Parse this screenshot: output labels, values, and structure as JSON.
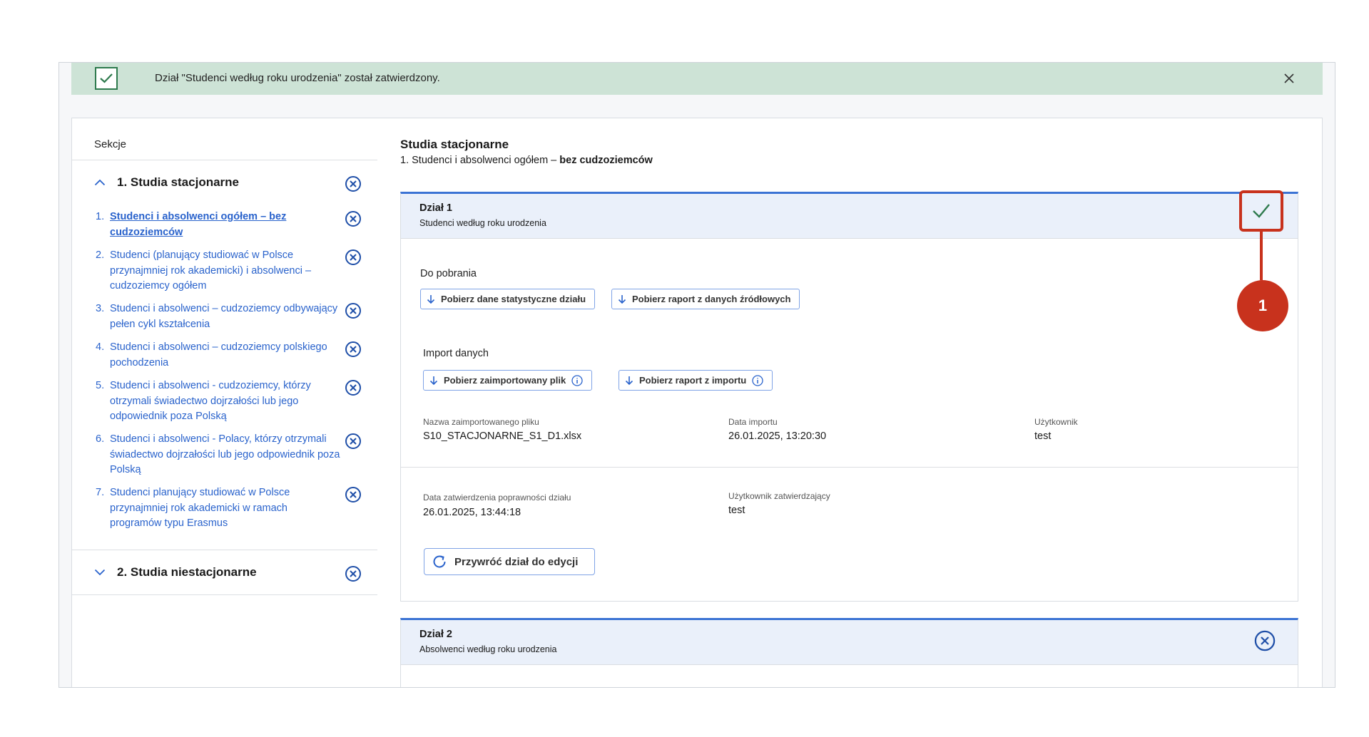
{
  "alert": {
    "message": "Dział \"Studenci według roku urodzenia\" został zatwierdzony."
  },
  "sidebar": {
    "title": "Sekcje",
    "groups": [
      {
        "label": "1. Studia stacjonarne"
      },
      {
        "label": "2. Studia niestacjonarne"
      }
    ],
    "items": [
      {
        "num": "1.",
        "label": "Studenci i absolwenci ogółem – bez cudzoziemców"
      },
      {
        "num": "2.",
        "label": "Studenci (planujący studiować w Polsce przynajmniej rok akademicki) i absolwenci – cudzoziemcy ogółem"
      },
      {
        "num": "3.",
        "label": "Studenci i absolwenci – cudzoziemcy odbywający pełen cykl kształcenia"
      },
      {
        "num": "4.",
        "label": "Studenci i absolwenci – cudzoziemcy polskiego pochodzenia"
      },
      {
        "num": "5.",
        "label": "Studenci i absolwenci - cudzoziemcy, którzy otrzymali świadectwo dojrzałości lub jego odpowiednik poza Polską"
      },
      {
        "num": "6.",
        "label": "Studenci i absolwenci - Polacy, którzy otrzymali świadectwo dojrzałości lub jego odpowiednik poza Polską"
      },
      {
        "num": "7.",
        "label": "Studenci planujący studiować w Polsce przynajmniej rok akademicki w ramach programów typu Erasmus"
      }
    ]
  },
  "main": {
    "title": "Studia stacjonarne",
    "subtitle_prefix": "1. Studenci i absolwenci ogółem – ",
    "subtitle_bold": "bez cudzoziemców",
    "section1": {
      "title": "Dział 1",
      "subtitle": "Studenci według roku urodzenia",
      "download_label": "Do pobrania",
      "btn_stats": "Pobierz dane statystyczne działu",
      "btn_source_report": "Pobierz raport z danych źródłowych",
      "import_label": "Import danych",
      "btn_imported_file": "Pobierz zaimportowany plik",
      "btn_import_report": "Pobierz raport z importu",
      "file_name_label": "Nazwa zaimportowanego pliku",
      "file_name": "S10_STACJONARNE_S1_D1.xlsx",
      "import_date_label": "Data importu",
      "import_date": "26.01.2025, 13:20:30",
      "user_label": "Użytkownik",
      "user": "test",
      "approval_date_label": "Data zatwierdzenia poprawności działu",
      "approval_date": "26.01.2025, 13:44:18",
      "approver_label": "Użytkownik zatwierdzający",
      "approver": "test",
      "restore_btn": "Przywróć dział do edycji"
    },
    "section2": {
      "title": "Dział 2",
      "subtitle": "Absolwenci według roku urodzenia"
    }
  },
  "callout": {
    "number": "1"
  },
  "colors": {
    "accent": "#3b73d4",
    "success": "#2e7a4d",
    "callout": "#c8321d",
    "alert_bg": "#cde3d6"
  }
}
